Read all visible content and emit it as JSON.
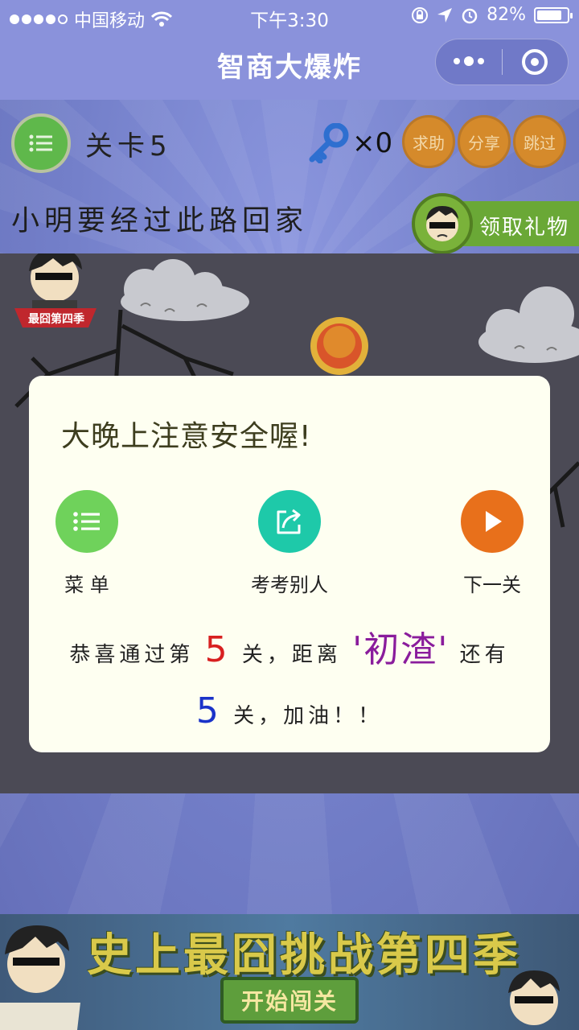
{
  "status": {
    "carrier": "中国移动",
    "time": "下午3:30",
    "battery": "82%",
    "battery_level": 0.82
  },
  "nav": {
    "title": "智商大爆炸"
  },
  "game": {
    "level_label": "关卡5",
    "key_count": "×0",
    "help_label": "求助",
    "share_label": "分享",
    "skip_label": "跳过",
    "question": "小明要经过此路回家",
    "gift_label": "领取礼物",
    "sticker_label": "最囧第四季"
  },
  "modal": {
    "title": "大晚上注意安全喔!",
    "menu_label": "菜 单",
    "quiz_label": "考考别人",
    "next_label": "下一关",
    "congrats_prefix": "恭喜通过第",
    "level_number": "5",
    "congrats_mid": "关，距离",
    "rank_title": "'初渣'",
    "congrats_mid2": "还有",
    "remaining_number": "5",
    "congrats_suffix": "关，加油！！"
  },
  "banner": {
    "title": "史上最囧挑战第四季",
    "button": "开始闯关"
  },
  "colors": {
    "nav": "#8a92db",
    "green": "#5fb84b",
    "teal": "#1ec9a9",
    "orange": "#e8701b",
    "pill": "#d58a2b"
  }
}
